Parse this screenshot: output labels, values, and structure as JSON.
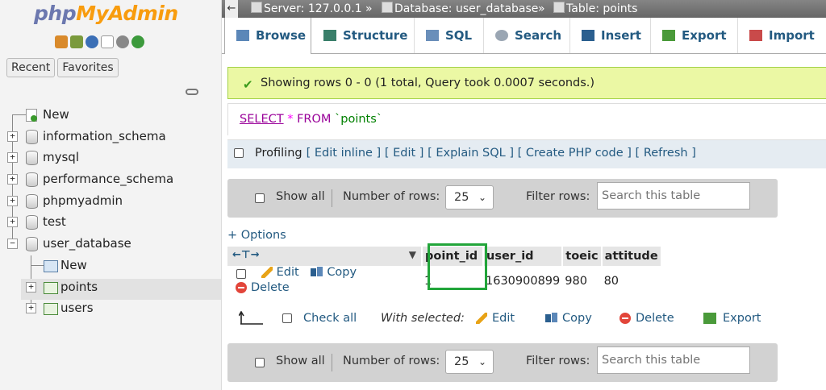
{
  "sidebar": {
    "logo": {
      "php": "php",
      "my": "My",
      "admin": "Admin"
    },
    "tabs": [
      "Recent",
      "Favorites"
    ],
    "tree": [
      {
        "label": "New",
        "type": "new"
      },
      {
        "label": "information_schema",
        "type": "db"
      },
      {
        "label": "mysql",
        "type": "db"
      },
      {
        "label": "performance_schema",
        "type": "db"
      },
      {
        "label": "phpmyadmin",
        "type": "db"
      },
      {
        "label": "test",
        "type": "db"
      },
      {
        "label": "user_database",
        "type": "db",
        "expanded": true
      },
      {
        "label": "New",
        "type": "new-table"
      },
      {
        "label": "points",
        "type": "table",
        "selected": true
      },
      {
        "label": "users",
        "type": "table"
      }
    ]
  },
  "breadcrumb": {
    "server": "Server: 127.0.0.1",
    "database": "Database: user_database",
    "table": "Table: points"
  },
  "tabs": [
    "Browse",
    "Structure",
    "SQL",
    "Search",
    "Insert",
    "Export",
    "Import"
  ],
  "active_tab": "Browse",
  "message": "Showing rows 0 - 0 (1 total, Query took 0.0007 seconds.)",
  "query": {
    "select": "SELECT",
    "star": "*",
    "from": "FROM",
    "table": "`points`"
  },
  "profiling": {
    "label": "Profiling",
    "links": [
      "Edit inline",
      "Edit",
      "Explain SQL",
      "Create PHP code",
      "Refresh"
    ]
  },
  "nav": {
    "show_all": "Show all",
    "num_rows_label": "Number of rows:",
    "num_rows_value": "25",
    "filter_label": "Filter rows:",
    "filter_placeholder": "Search this table"
  },
  "options_link": "+ Options",
  "columns": [
    "point_id",
    "user_id",
    "toeic",
    "attitude"
  ],
  "rows": [
    {
      "point_id": "1",
      "user_id": "1630900899",
      "toeic": "980",
      "attitude": "80"
    }
  ],
  "row_actions": {
    "edit": "Edit",
    "copy": "Copy",
    "delete": "Delete"
  },
  "bulk": {
    "check_all": "Check all",
    "with_selected": "With selected:",
    "edit": "Edit",
    "copy": "Copy",
    "delete": "Delete",
    "export": "Export"
  },
  "colors": {
    "highlight": "#22a53a",
    "success_bg": "#ebf8a4",
    "link": "#235a81"
  }
}
